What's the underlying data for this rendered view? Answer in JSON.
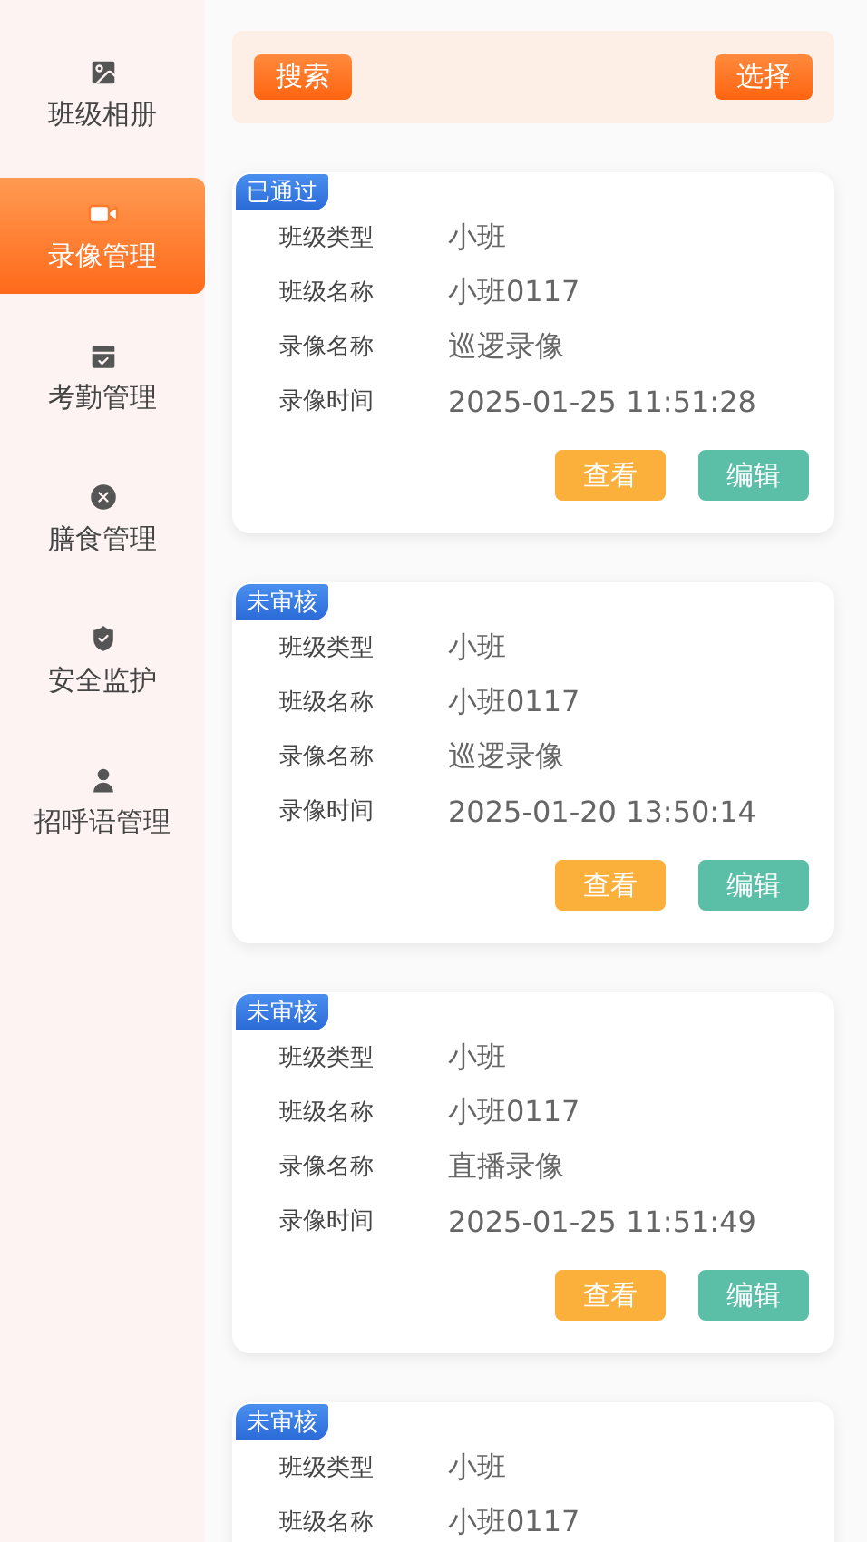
{
  "sidebar": {
    "items": [
      {
        "kind": "image",
        "label": "班级相册",
        "selected": false
      },
      {
        "kind": "video",
        "label": "录像管理",
        "selected": true
      },
      {
        "kind": "calendar",
        "label": "考勤管理",
        "selected": false
      },
      {
        "kind": "meal",
        "label": "膳食管理",
        "selected": false
      },
      {
        "kind": "shield",
        "label": "安全监护",
        "selected": false
      },
      {
        "kind": "person",
        "label": "招呼语管理",
        "selected": false
      }
    ]
  },
  "toolbar": {
    "buttons": [
      "搜索",
      "选择"
    ]
  },
  "records": [
    {
      "status": "已通过",
      "fields": [
        {
          "label": "班级类型",
          "value": "小班"
        },
        {
          "label": "班级名称",
          "value": "小班0117"
        },
        {
          "label": "录像名称",
          "value": "巡逻录像"
        },
        {
          "label": "录像时间",
          "value": "2025-01-25 11:51:28"
        }
      ],
      "actions": [
        {
          "kind": "view",
          "label": "查看"
        },
        {
          "kind": "edit",
          "label": "编辑"
        }
      ]
    },
    {
      "status": "未审核",
      "fields": [
        {
          "label": "班级类型",
          "value": "小班"
        },
        {
          "label": "班级名称",
          "value": "小班0117"
        },
        {
          "label": "录像名称",
          "value": "巡逻录像"
        },
        {
          "label": "录像时间",
          "value": "2025-01-20 13:50:14"
        }
      ],
      "actions": [
        {
          "kind": "view",
          "label": "查看"
        },
        {
          "kind": "edit",
          "label": "编辑"
        }
      ]
    },
    {
      "status": "未审核",
      "fields": [
        {
          "label": "班级类型",
          "value": "小班"
        },
        {
          "label": "班级名称",
          "value": "小班0117"
        },
        {
          "label": "录像名称",
          "value": "直播录像"
        },
        {
          "label": "录像时间",
          "value": "2025-01-25 11:51:49"
        }
      ],
      "actions": [
        {
          "kind": "view",
          "label": "查看"
        },
        {
          "kind": "edit",
          "label": "编辑"
        }
      ]
    },
    {
      "status": "未审核",
      "fields": [
        {
          "label": "班级类型",
          "value": "小班"
        },
        {
          "label": "班级名称",
          "value": "小班0117"
        }
      ]
    }
  ]
}
